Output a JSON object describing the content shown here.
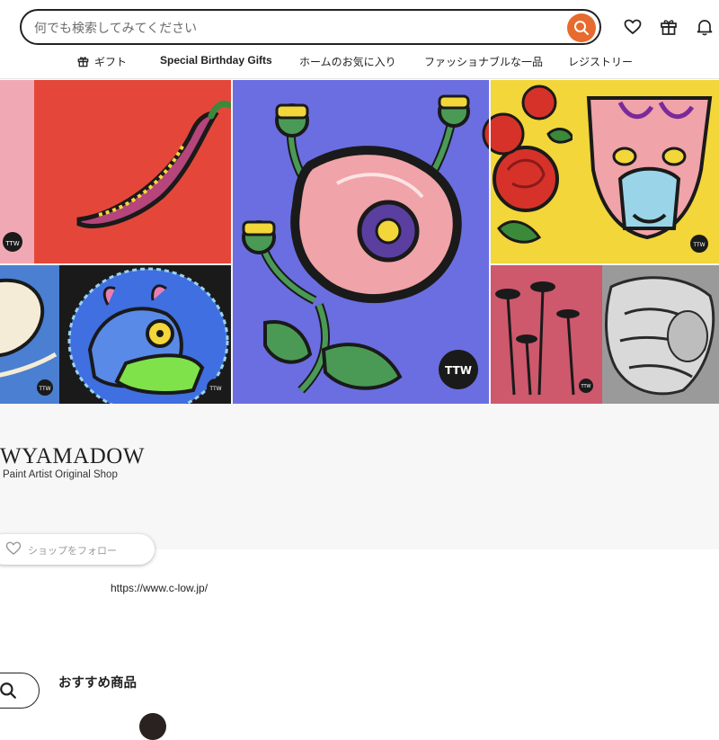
{
  "header": {
    "left_stub": "-",
    "search": {
      "placeholder": "何でも検索してみてください",
      "value": ""
    },
    "icons": [
      "heart-icon",
      "gift-icon",
      "bell-icon"
    ]
  },
  "subnav": {
    "items": [
      {
        "label": "ギフト",
        "icon": "gift-icon"
      },
      {
        "label": "Special Birthday Gifts"
      },
      {
        "label": "ホームのお気に入り"
      },
      {
        "label": "ファッショナブルな一品"
      },
      {
        "label": "レジストリー"
      }
    ]
  },
  "banner": {
    "signatures": [
      "TTW",
      "TTW",
      "TTW",
      "TTW",
      "TTW",
      "TTW"
    ]
  },
  "shop": {
    "name": "WYAMADOW",
    "tagline": "Paint Artist Original Shop",
    "follow_label": "ショップをフォロー",
    "url": "https://www.c-low.jp/"
  },
  "section": {
    "recommended_title": "おすすめ商品"
  },
  "colors": {
    "accent": "#e76a2e",
    "shop_area_bg": "#f7f7f7",
    "banner_blue": "#6b6ee0",
    "banner_red": "#e4473a",
    "banner_yellow": "#f2d63a"
  }
}
